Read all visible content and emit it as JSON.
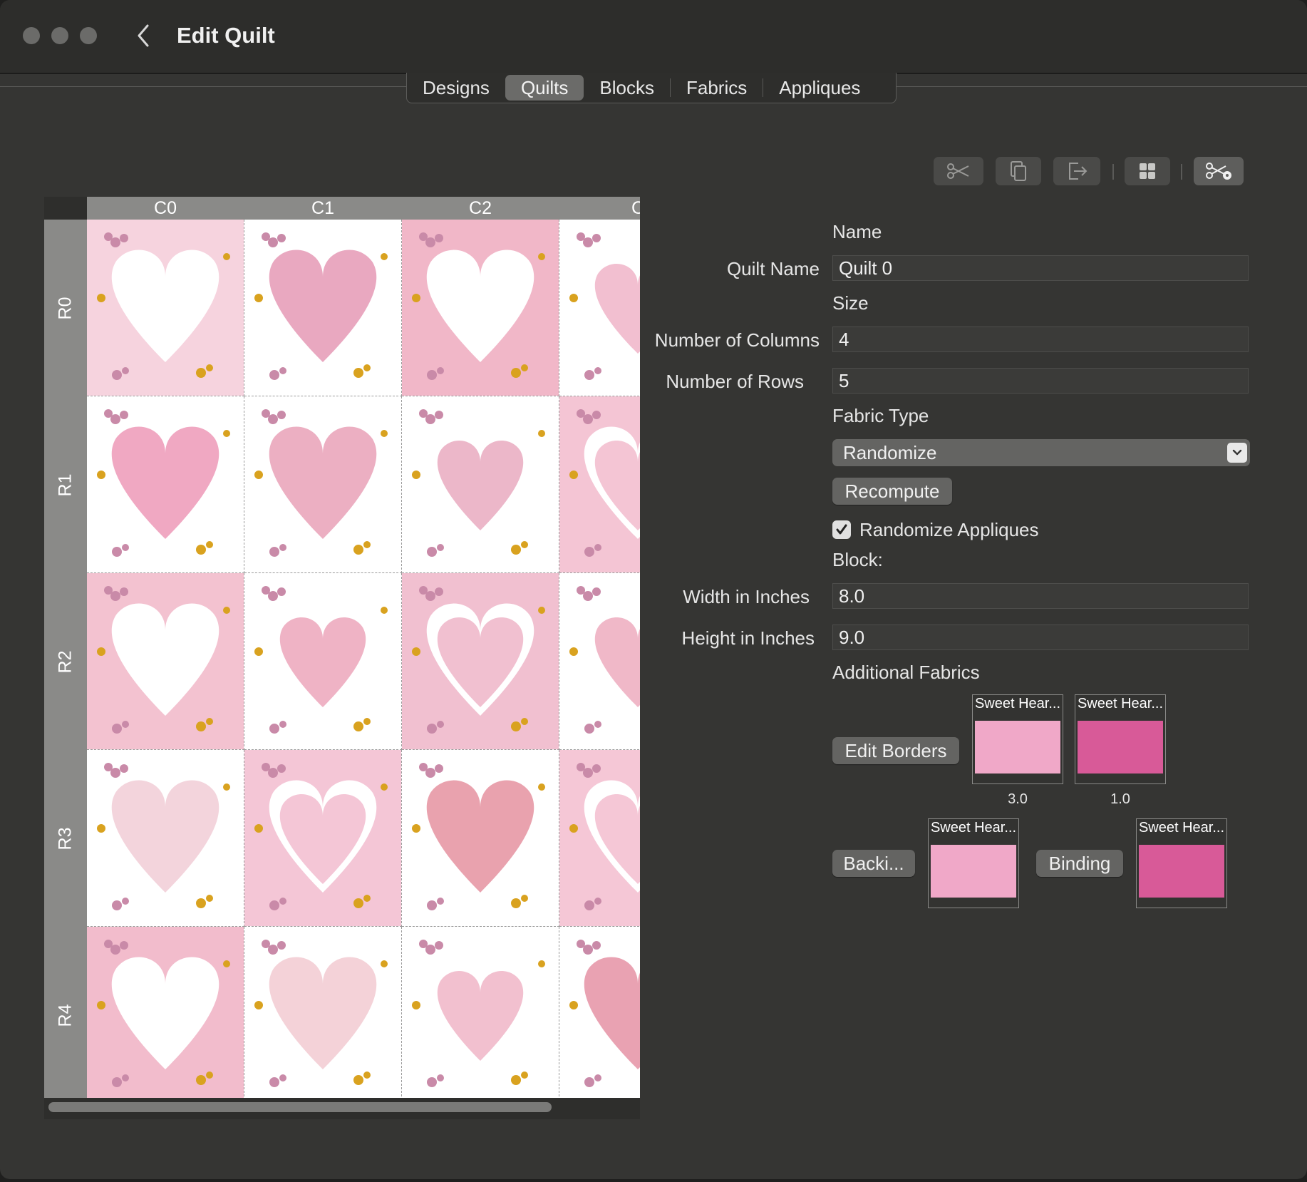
{
  "window": {
    "title": "Edit Quilt"
  },
  "tabs": [
    {
      "label": "Designs",
      "active": false
    },
    {
      "label": "Quilts",
      "active": true
    },
    {
      "label": "Blocks",
      "active": false
    },
    {
      "label": "Fabrics",
      "active": false
    },
    {
      "label": "Appliques",
      "active": false
    }
  ],
  "toolbar": {
    "icons": [
      "scissors-icon",
      "copy-icon",
      "export-icon",
      "grid-icon",
      "cut-settings-icon"
    ]
  },
  "grid": {
    "column_headers": [
      "C0",
      "C1",
      "C2",
      "C"
    ],
    "row_headers": [
      "R0",
      "R1",
      "R2",
      "R3",
      "R4"
    ]
  },
  "form": {
    "name_section": "Name",
    "quilt_name_label": "Quilt Name",
    "quilt_name_value": "Quilt 0",
    "size_section": "Size",
    "columns_label": "Number of Columns",
    "columns_value": "4",
    "rows_label": "Number of Rows",
    "rows_value": "5",
    "fabric_type_section": "Fabric Type",
    "fabric_type_value": "Randomize",
    "recompute_label": "Recompute",
    "randomize_appliques_label": "Randomize Appliques",
    "randomize_appliques_checked": true,
    "block_section": "Block:",
    "width_label": "Width in Inches",
    "width_value": "8.0",
    "height_label": "Height in Inches",
    "height_value": "9.0",
    "additional_fabrics_section": "Additional Fabrics",
    "edit_borders_label": "Edit Borders",
    "borders": [
      {
        "name": "Sweet Hear...",
        "value": "3.0",
        "color": "#f0a8c8"
      },
      {
        "name": "Sweet Hear...",
        "value": "1.0",
        "color": "#d85a98"
      }
    ],
    "backing_label": "Backi...",
    "backing_fabric": {
      "name": "Sweet Hear...",
      "color": "#f0a8c8"
    },
    "binding_label": "Binding",
    "binding_fabric": {
      "name": "Sweet Hear...",
      "color": "#d85a98"
    }
  },
  "colors": {
    "background": "#353533",
    "pink_light": "#f4c6d6",
    "pink_mid": "#e9a2ba",
    "pink_dark": "#d85a98",
    "gold": "#e0a820"
  }
}
